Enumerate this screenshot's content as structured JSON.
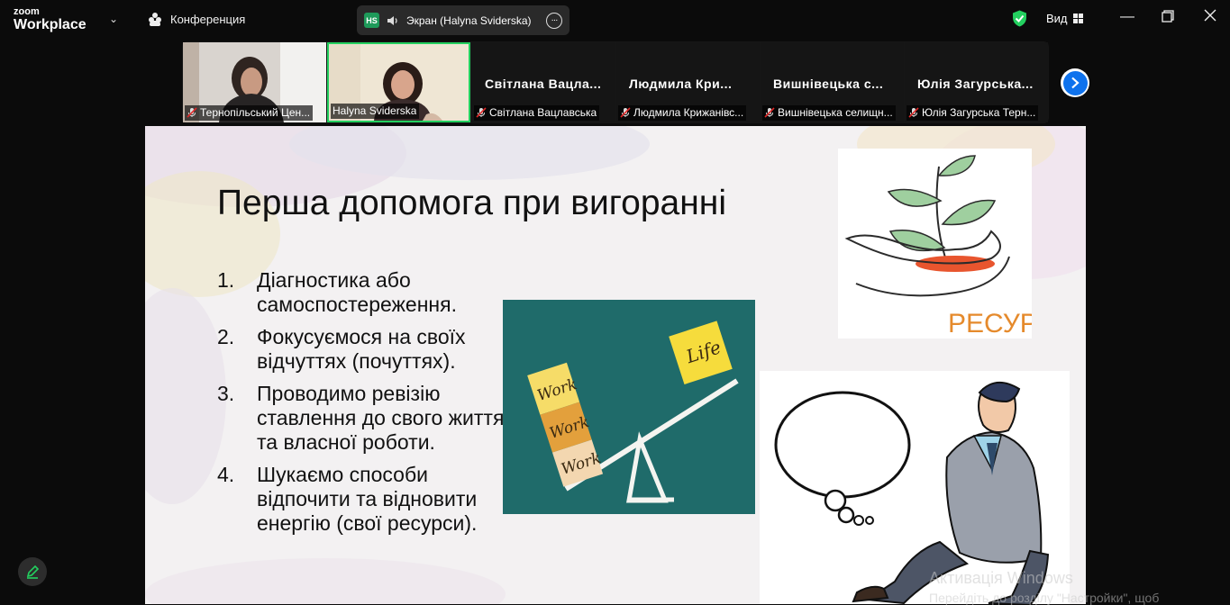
{
  "app": {
    "logo_top": "zoom",
    "logo_bottom": "Workplace"
  },
  "topbar": {
    "conference_label": "Конференция",
    "share_label": "Экран (Halyna Sviderska)",
    "share_initials": "HS",
    "view_label": "Вид"
  },
  "gallery": {
    "tiles": [
      {
        "caption": "Тернопільський Цен...",
        "muted": true,
        "video": true
      },
      {
        "caption": "Halyna Sviderska",
        "muted": false,
        "video": true,
        "active": true
      },
      {
        "name": "Світлана Вацла...",
        "caption": "Світлана Вацлавська",
        "muted": true
      },
      {
        "name": "Людмила Кри...",
        "caption": "Людмила Крижанівс...",
        "muted": true
      },
      {
        "name": "Вишнівецька с...",
        "caption": "Вишнівецька селищн...",
        "muted": true
      },
      {
        "name": "Юлія Загурська...",
        "caption": "Юлія Загурська Терн...",
        "muted": true
      }
    ]
  },
  "slide": {
    "title": "Перша допомога при вигоранні",
    "items": [
      {
        "num": "1.",
        "text": "Діагностика або самоспостереження."
      },
      {
        "num": "2.",
        "text": "Фокусуємося на своїх відчуттях (почуттях)."
      },
      {
        "num": "3.",
        "text": "Проводимо ревізію ставлення до свого життя та власної роботи."
      },
      {
        "num": "4.",
        "text": "Шукаємо способи відпочити та відновити енергію (свої ресурси)."
      }
    ],
    "balance_words": {
      "work": "Work",
      "life": "Life"
    },
    "resource_label": "РЕСУРС"
  },
  "os": {
    "watermark_title": "Активація Windows",
    "watermark_sub": "Перейдіть до розділу \"Настройки\", щоб"
  },
  "colors": {
    "accent": "#0e72ed",
    "active_border": "#23d05f",
    "mute": "#e02828",
    "shield": "#23d05f"
  }
}
